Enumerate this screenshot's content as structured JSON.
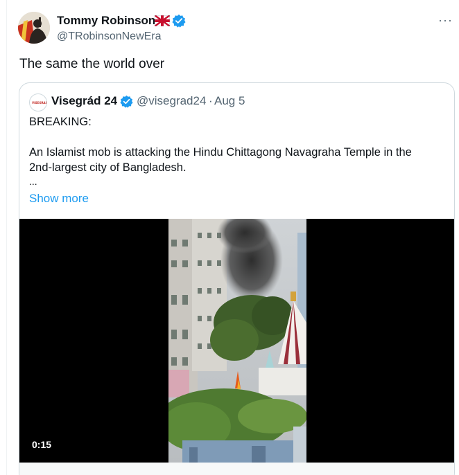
{
  "tweet": {
    "author_name": "Tommy Robinson",
    "author_handle": "@TRobinsonNewEra",
    "more_label": "···",
    "text": "The same the world over",
    "flag": "uk-flag-icon",
    "verified": "verified-badge-icon"
  },
  "quote": {
    "avatar_text": "VISEGRAD24",
    "author_name": "Visegrád 24",
    "author_handle": "@visegrad24",
    "separator": "·",
    "date": "Aug 5",
    "line1": "BREAKING:",
    "line2": "An Islamist mob is attacking the Hindu Chittagong Navagraha Temple in the",
    "line3": "2nd-largest city of Bangladesh.",
    "ellipsis": "...",
    "show_more": "Show more",
    "video_time": "0:15"
  },
  "colors": {
    "link": "#1d9bf0",
    "verified": "#1d9bf0",
    "secondary_text": "#536471",
    "border": "#cfd9de"
  }
}
